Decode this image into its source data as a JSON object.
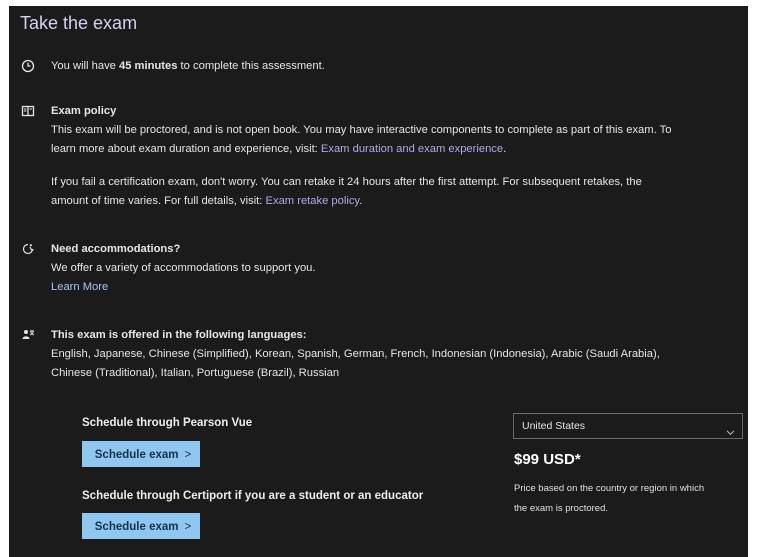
{
  "title": "Take the exam",
  "duration": {
    "prefix": "You will have ",
    "emphasis": "45 minutes",
    "suffix": " to complete this assessment."
  },
  "policy": {
    "heading": "Exam policy",
    "p1_line1": "This exam will be proctored, and is not open book. You may have interactive components to complete as part of this exam. To",
    "p1_line2_prefix": "learn more about exam duration and experience, visit: ",
    "p1_link": "Exam duration and exam experience",
    "p1_line2_suffix": ".",
    "p2_line1": "If you fail a certification exam, don't worry. You can retake it 24 hours after the first attempt. For subsequent retakes, the",
    "p2_line2_prefix": "amount of time varies. For full details, visit: ",
    "p2_link": "Exam retake policy",
    "p2_line2_suffix": "."
  },
  "accommodations": {
    "heading": "Need accommodations?",
    "text": "We offer a variety of accommodations to support you.",
    "link": "Learn More"
  },
  "languages": {
    "heading": "This exam is offered in the following languages:",
    "line1": "English, Japanese, Chinese (Simplified), Korean, Spanish, German, French, Indonesian (Indonesia), Arabic (Saudi Arabia),",
    "line2": "Chinese (Traditional), Italian, Portuguese (Brazil), Russian"
  },
  "schedule": {
    "pearson_heading": "Schedule through Pearson Vue",
    "pearson_button": "Schedule exam",
    "certiport_heading": "Schedule through Certiport if you are a student or an educator",
    "certiport_button": "Schedule exam",
    "chevron": ">"
  },
  "pricing": {
    "country": "United States",
    "price": "$99 USD*",
    "note_line1": "Price based on the country or region in which",
    "note_line2": "the exam is proctored."
  },
  "icons": [
    "clock-icon",
    "book-icon",
    "accessibility-icon",
    "language-people-icon",
    "chevron-down-icon",
    "chevron-right-icon"
  ],
  "colors": {
    "background": "#1b1b1b",
    "title": "#d8cff1",
    "link": "#b6a7e8",
    "button": "#8fc7f0",
    "button_text": "#15314d"
  }
}
